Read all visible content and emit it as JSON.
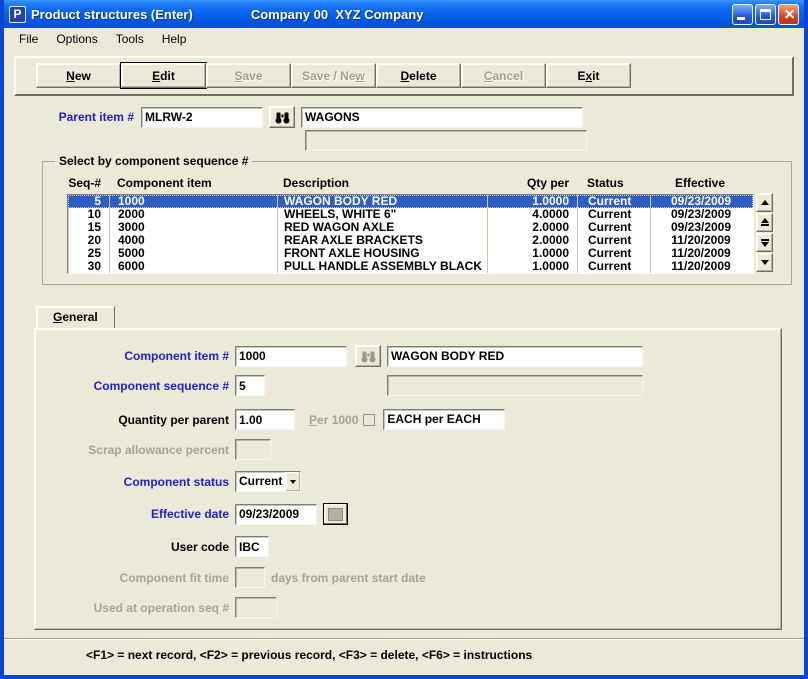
{
  "window": {
    "icon_letter": "P",
    "title": "Product structures (Enter)",
    "company": "Company 00  XYZ Company"
  },
  "menubar": {
    "items": [
      "File",
      "Options",
      "Tools",
      "Help"
    ]
  },
  "toolbar": {
    "buttons": [
      {
        "pre": "",
        "key": "N",
        "post": "ew",
        "enabled": true,
        "focused": false
      },
      {
        "pre": "",
        "key": "E",
        "post": "dit",
        "enabled": true,
        "focused": true
      },
      {
        "pre": "",
        "key": "S",
        "post": "ave",
        "enabled": false,
        "focused": false
      },
      {
        "pre": "Save / Ne",
        "key": "w",
        "post": "",
        "enabled": false,
        "focused": false
      },
      {
        "pre": "",
        "key": "D",
        "post": "elete",
        "enabled": true,
        "focused": false
      },
      {
        "pre": "",
        "key": "C",
        "post": "ancel",
        "enabled": false,
        "focused": false
      },
      {
        "pre": "E",
        "key": "x",
        "post": "it",
        "enabled": true,
        "focused": false
      }
    ]
  },
  "parent": {
    "label": "Parent item #",
    "value": "MLRW-2",
    "description": "WAGONS",
    "description2": ""
  },
  "list": {
    "group_label": "Select by component sequence #",
    "headers": [
      "Seq-#",
      "Component item",
      "Description",
      "Qty per",
      "Status",
      "Effective"
    ],
    "rows": [
      {
        "selected": true,
        "cells": [
          "5",
          "1000",
          "WAGON BODY RED",
          "1.0000",
          "Current",
          "09/23/2009"
        ]
      },
      {
        "selected": false,
        "cells": [
          "10",
          "2000",
          "WHEELS, WHITE 6\"",
          "4.0000",
          "Current",
          "09/23/2009"
        ]
      },
      {
        "selected": false,
        "cells": [
          "15",
          "3000",
          "RED WAGON AXLE",
          "2.0000",
          "Current",
          "09/23/2009"
        ]
      },
      {
        "selected": false,
        "cells": [
          "20",
          "4000",
          "REAR AXLE BRACKETS",
          "2.0000",
          "Current",
          "11/20/2009"
        ]
      },
      {
        "selected": false,
        "cells": [
          "25",
          "5000",
          "FRONT AXLE HOUSING",
          "1.0000",
          "Current",
          "11/20/2009"
        ]
      },
      {
        "selected": false,
        "cells": [
          "30",
          "6000",
          "PULL HANDLE ASSEMBLY BLACK",
          "1.0000",
          "Current",
          "11/20/2009"
        ]
      }
    ]
  },
  "tab": {
    "pre": "",
    "key": "G",
    "post": "eneral"
  },
  "form": {
    "component_item": {
      "label": "Component item #",
      "value": "1000",
      "description": "WAGON BODY RED",
      "description2": ""
    },
    "component_sequence": {
      "label": "Component sequence #",
      "value": "5"
    },
    "quantity": {
      "label": "Quantity per parent",
      "value": "1.00",
      "per_pre": "",
      "per_key": "P",
      "per_post": "er 1000",
      "uom": "EACH per EACH"
    },
    "scrap": {
      "label": "Scrap allowance percent",
      "value": ""
    },
    "status": {
      "label": "Component status",
      "value": "Current"
    },
    "effective": {
      "label": "Effective date",
      "value": "09/23/2009"
    },
    "user_code": {
      "label": "User code",
      "value": "IBC"
    },
    "fit_time": {
      "label": "Component fit time",
      "value": "",
      "suffix": "days from parent start date"
    },
    "used_at": {
      "label": "Used at operation seq #",
      "value": ""
    }
  },
  "statusbar": {
    "text": "<F1> = next record, <F2> = previous record, <F3> = delete, <F6> = instructions"
  },
  "colors": {
    "background": "#ece9d8",
    "window_border": "#0845d6",
    "titlebar_gradient_top": "#3d96ff",
    "titlebar_gradient_bottom": "#0a53c8",
    "label_blue": "#2222cc",
    "disabled_text": "#a7a396",
    "selection_background": "#2e5ec2",
    "selection_text": "#ffffff"
  }
}
